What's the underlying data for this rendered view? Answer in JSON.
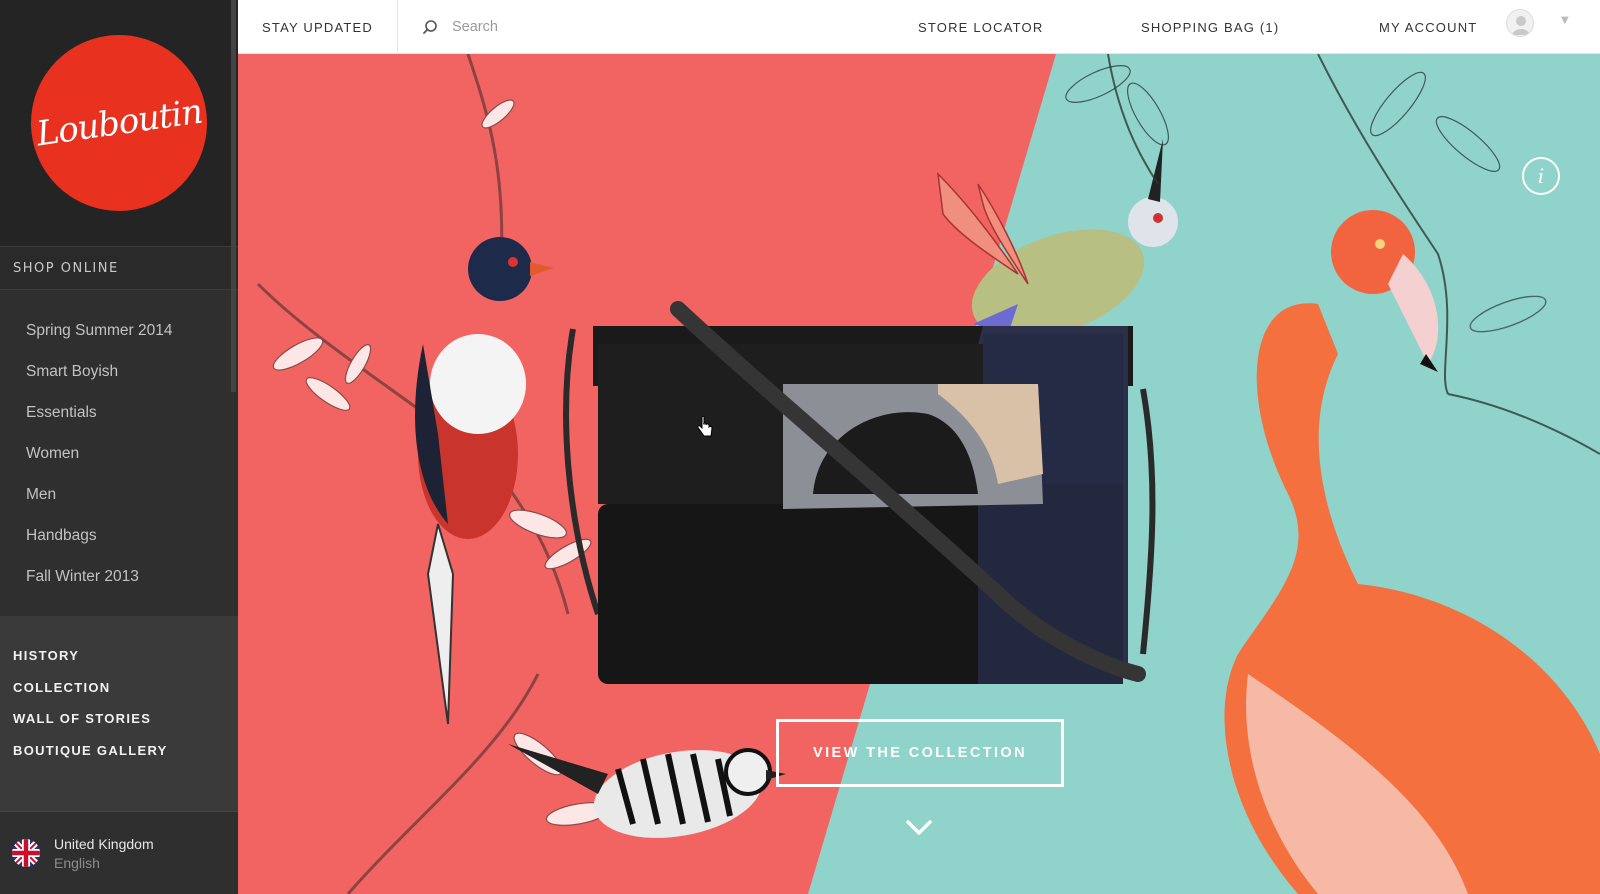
{
  "brand": {
    "logo_text": "Louboutin"
  },
  "sidebar": {
    "section_title": "SHOP ONLINE",
    "shop_items": [
      {
        "label": "Spring Summer 2014"
      },
      {
        "label": "Smart Boyish"
      },
      {
        "label": "Essentials"
      },
      {
        "label": "Women"
      },
      {
        "label": "Men"
      },
      {
        "label": "Handbags"
      },
      {
        "label": "Fall Winter 2013"
      }
    ],
    "brand_nav": [
      {
        "label": "HISTORY"
      },
      {
        "label": "COLLECTION"
      },
      {
        "label": "WALL OF STORIES"
      },
      {
        "label": "BOUTIQUE GALLERY"
      }
    ],
    "locale": {
      "country": "United Kingdom",
      "language": "English",
      "flag_icon": "uk-flag-icon"
    }
  },
  "header": {
    "stay_updated": "STAY UPDATED",
    "search": {
      "placeholder": "Search",
      "value": ""
    },
    "store_locator": "STORE LOCATOR",
    "shopping_bag": "SHOPPING BAG (1)",
    "my_account": "MY ACCOUNT"
  },
  "hero": {
    "cta_label": "VIEW THE COLLECTION",
    "info_glyph": "i",
    "colors": {
      "left_bg": "#f26461",
      "right_bg": "#8fd3cb",
      "logo": "#e8321f"
    }
  }
}
